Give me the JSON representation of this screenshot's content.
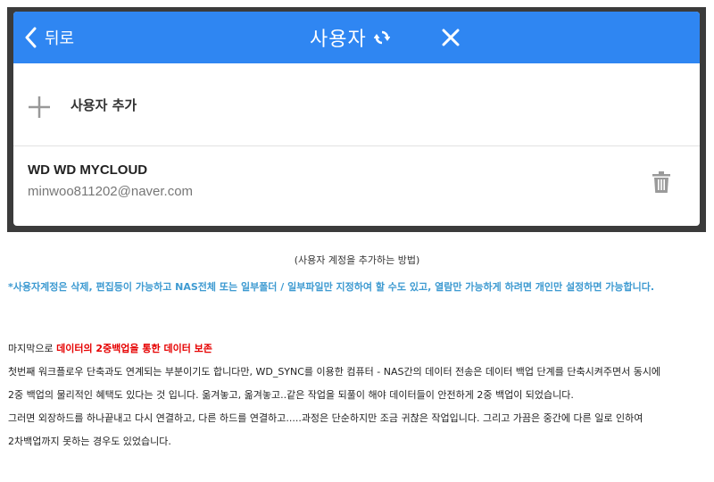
{
  "app": {
    "back_label": "뒤로",
    "title": "사용자",
    "add_user_label": "사용자 추가",
    "user": {
      "name": "WD WD MYCLOUD",
      "email": "minwoo811202@naver.com"
    },
    "colors": {
      "header": "#2f86f2"
    },
    "icons": [
      "back-chevron-icon",
      "sync-icon",
      "close-icon",
      "plus-icon",
      "trash-icon"
    ]
  },
  "article": {
    "caption": "(사용자 계정을 추가하는 방법)",
    "note": "*사용자계정은 삭제, 편집등이 가능하고 NAS전체 또는 일부폴더 / 일부파일만 지정하여 할 수도 있고, 열람만 가능하게 하려면 개인만 설정하면 가능합니다.",
    "intro_prefix": "마지막으로 ",
    "intro_highlight": "데이터의 2중백업을 통한 데이터 보존",
    "lines": [
      "첫번째 워크플로우 단축과도 연계되는 부분이기도 합니다만, WD_SYNC를 이용한 컴퓨터 - NAS간의 데이터 전송은 데이터 백업 단계를 단축시켜주면서 동시에",
      "2중 백업의 물리적인 혜택도 있다는 것 입니다. 옮겨놓고, 옮겨놓고..같은 작업을 되풀이 해야 데이터들이 안전하게 2중 백업이 되었습니다.",
      "그러면 외장하드를 하나끝내고 다시 연결하고, 다른 하드를 연결하고.....과정은 단순하지만 조금 귀찮은 작업입니다. 그리고 가끔은 중간에 다른 일로 인하여",
      "2차백업까지 못하는 경우도 있었습니다."
    ]
  }
}
